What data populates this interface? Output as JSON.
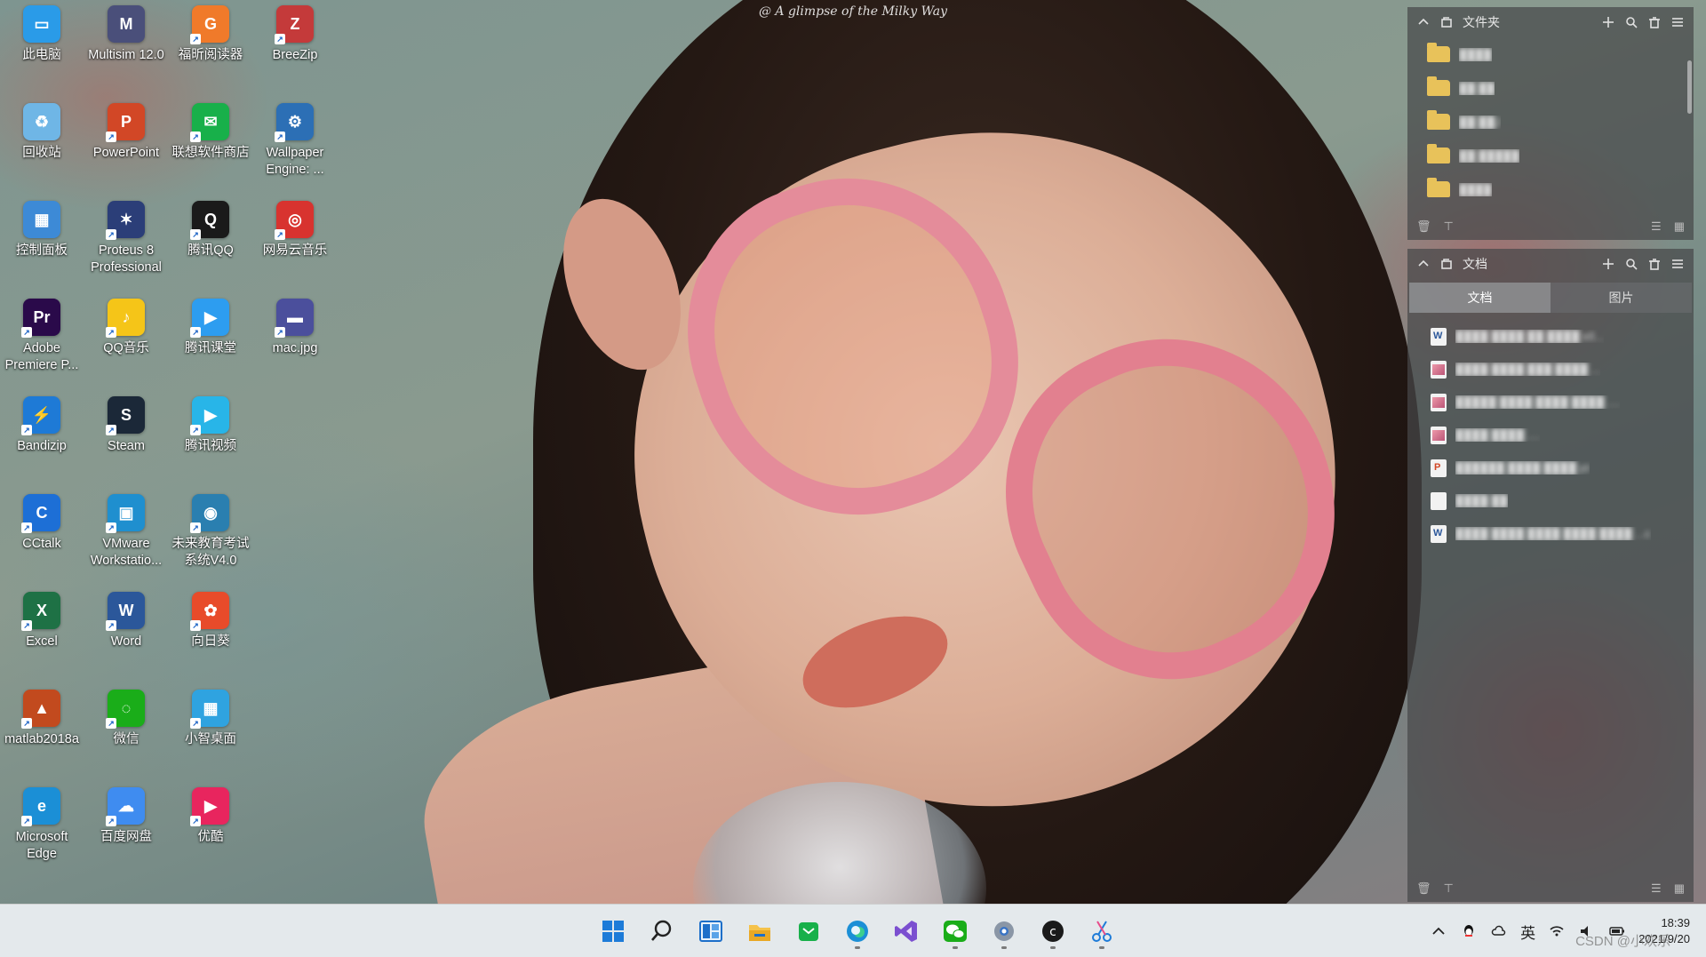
{
  "wallpaper": {
    "caption": "@ A glimpse of the Milky Way"
  },
  "desktop_icons": [
    {
      "label": "此电脑",
      "icon": "this-pc-icon",
      "color": "#2a9be8",
      "glyph": "▭"
    },
    {
      "label": "Multisim 12.0",
      "icon": "multisim-icon",
      "color": "#4a4f7a",
      "glyph": "M"
    },
    {
      "label": "福昕阅读器",
      "icon": "foxit-reader-icon",
      "color": "#f07a2a",
      "glyph": "G"
    },
    {
      "label": "BreeZip",
      "icon": "breezip-icon",
      "color": "#c43a3a",
      "glyph": "Z"
    },
    {
      "label": "回收站",
      "icon": "recycle-bin-icon",
      "color": "#6fb6e6",
      "glyph": "♻"
    },
    {
      "label": "PowerPoint",
      "icon": "powerpoint-icon",
      "color": "#d24726",
      "glyph": "P"
    },
    {
      "label": "联想软件商店",
      "icon": "lenovo-store-icon",
      "color": "#18b04a",
      "glyph": "✉"
    },
    {
      "label": "Wallpaper Engine: ...",
      "icon": "wallpaper-engine-icon",
      "color": "#2c6fb5",
      "glyph": "⚙"
    },
    {
      "label": "控制面板",
      "icon": "control-panel-icon",
      "color": "#3d8ad6",
      "glyph": "▦"
    },
    {
      "label": "Proteus 8 Professional",
      "icon": "proteus-icon",
      "color": "#2b3e78",
      "glyph": "✶"
    },
    {
      "label": "腾讯QQ",
      "icon": "qq-icon",
      "color": "#1a1a1a",
      "glyph": "Q"
    },
    {
      "label": "网易云音乐",
      "icon": "netease-music-icon",
      "color": "#d8332f",
      "glyph": "◎"
    },
    {
      "label": "Adobe Premiere P...",
      "icon": "premiere-icon",
      "color": "#2a0a4a",
      "glyph": "Pr"
    },
    {
      "label": "QQ音乐",
      "icon": "qq-music-icon",
      "color": "#f5c518",
      "glyph": "♪"
    },
    {
      "label": "腾讯课堂",
      "icon": "tencent-class-icon",
      "color": "#2d9df0",
      "glyph": "▶"
    },
    {
      "label": "mac.jpg",
      "icon": "image-file-icon",
      "color": "#4b4f9c",
      "glyph": "▬"
    },
    {
      "label": "Bandizip",
      "icon": "bandizip-icon",
      "color": "#1e7ad6",
      "glyph": "⚡"
    },
    {
      "label": "Steam",
      "icon": "steam-icon",
      "color": "#1b2838",
      "glyph": "S"
    },
    {
      "label": "腾讯视频",
      "icon": "tencent-video-icon",
      "color": "#28b5e8",
      "glyph": "▶"
    },
    {
      "label": "CCtalk",
      "icon": "cctalk-icon",
      "color": "#1d6fd6",
      "glyph": "C"
    },
    {
      "label": "VMware Workstatio...",
      "icon": "vmware-icon",
      "color": "#1f8fcf",
      "glyph": "▣"
    },
    {
      "label": "未来教育考试系统V4.0",
      "icon": "future-edu-icon",
      "color": "#2a7fb0",
      "glyph": "◉"
    },
    {
      "label": "Excel",
      "icon": "excel-icon",
      "color": "#1e7145",
      "glyph": "X"
    },
    {
      "label": "Word",
      "icon": "word-icon",
      "color": "#2b579a",
      "glyph": "W"
    },
    {
      "label": "向日葵",
      "icon": "sunflower-icon",
      "color": "#e84b2a",
      "glyph": "✿"
    },
    {
      "label": "matlab2018a",
      "icon": "matlab-icon",
      "color": "#c24a1e",
      "glyph": "▲"
    },
    {
      "label": "微信",
      "icon": "wechat-icon",
      "color": "#1aad19",
      "glyph": "◌"
    },
    {
      "label": "小智桌面",
      "icon": "xiaozhi-desktop-icon",
      "color": "#2fa3e0",
      "glyph": "▦"
    },
    {
      "label": "Microsoft Edge",
      "icon": "edge-icon",
      "color": "#1b8fd6",
      "glyph": "e"
    },
    {
      "label": "百度网盘",
      "icon": "baidu-netdisk-icon",
      "color": "#3f8cf0",
      "glyph": "☁"
    },
    {
      "label": "优酷",
      "icon": "youku-icon",
      "color": "#e8255e",
      "glyph": "▶"
    }
  ],
  "folder_panel": {
    "title": "文件夹",
    "rows": [
      "████",
      "██ ██",
      "██ ██J",
      "██ █████",
      "████"
    ]
  },
  "docs_panel": {
    "title": "文档",
    "tabs": [
      "文档",
      "图片"
    ],
    "active_tab": 0,
    "rows": [
      {
        "type": "word",
        "text": "████ ████ ██ ████ ell..."
      },
      {
        "type": "img",
        "text": "████ ████ ███ ████ ..."
      },
      {
        "type": "img",
        "text": "█████ ████ ████ ████ ...."
      },
      {
        "type": "img",
        "text": "████ ████ ...."
      },
      {
        "type": "pdf",
        "text": "██████ ████ ████ pt"
      },
      {
        "type": "plain",
        "text": "████ ██"
      },
      {
        "type": "word",
        "text": "████ ████ ████ ████ ████ ...c"
      }
    ]
  },
  "taskbar": {
    "apps": [
      "start-icon",
      "search-icon",
      "snap-layout-icon",
      "file-explorer-icon",
      "store-icon",
      "edge-icon",
      "visual-studio-icon",
      "wechat-icon",
      "settings-icon",
      "app-icon",
      "snipping-tool-icon"
    ],
    "tray_lang": "英",
    "time": "18:39",
    "date": "2021/9/20"
  },
  "corner_mark": "CSDN @小欢乐"
}
